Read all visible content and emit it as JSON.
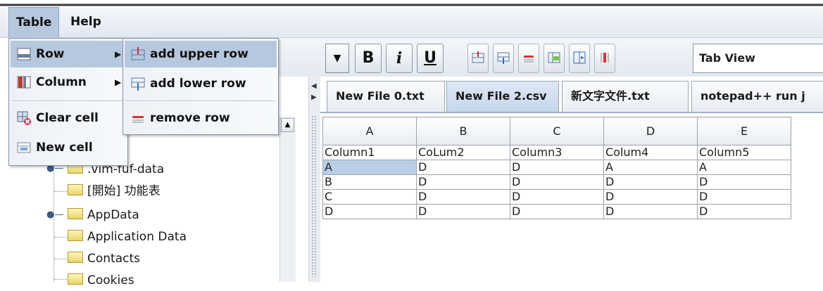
{
  "menubar": {
    "table": "Table",
    "help": "Help"
  },
  "table_menu": {
    "row": "Row",
    "column": "Column",
    "clear_cell": "Clear cell",
    "new_cell": "New cell"
  },
  "row_submenu": {
    "add_upper_row": "add upper row",
    "add_lower_row": "add lower row",
    "remove_row": "remove row"
  },
  "toolbar": {
    "bold": "B",
    "italic": "i",
    "underline": "U",
    "view_mode": "Tab View"
  },
  "tree": {
    "items": [
      {
        "label": ".vim-fuf-data",
        "expandable": true
      },
      {
        "label": "[開始] 功能表",
        "expandable": false
      },
      {
        "label": "AppData",
        "expandable": true
      },
      {
        "label": "Application Data",
        "expandable": false
      },
      {
        "label": "Contacts",
        "expandable": false
      },
      {
        "label": "Cookies",
        "expandable": false
      }
    ]
  },
  "tabs": [
    {
      "label": "New File 0.txt",
      "selected": false
    },
    {
      "label": "New File 2.csv",
      "selected": true
    },
    {
      "label": "新文字文件.txt",
      "selected": false
    },
    {
      "label": "notepad++ run j",
      "selected": false
    }
  ],
  "grid": {
    "headers": [
      "A",
      "B",
      "C",
      "D",
      "E"
    ],
    "rows": [
      [
        "Column1",
        "CoLum2",
        "Column3",
        "Colum4",
        "Column5"
      ],
      [
        "A",
        "D",
        "D",
        "A",
        "A"
      ],
      [
        "B",
        "D",
        "D",
        "D",
        "D"
      ],
      [
        "C",
        "D",
        "D",
        "D",
        "D"
      ],
      [
        "D",
        "D",
        "D",
        "D",
        "D"
      ]
    ],
    "selected_cell": "A"
  },
  "colors": {
    "menu_highlight": "#b6c8de",
    "selected_cell": "#b8cfe7",
    "tab_selected": "#c5d6ec"
  }
}
